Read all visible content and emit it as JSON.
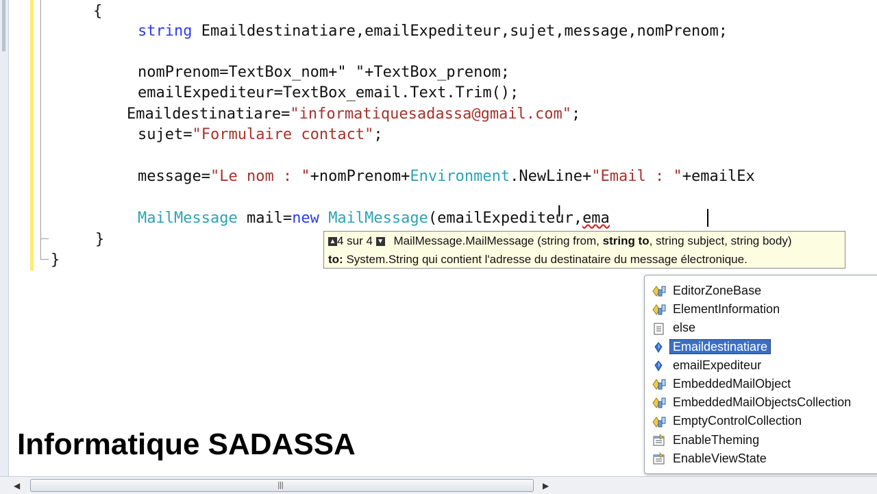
{
  "editor": {
    "open_brace": "{",
    "close_brace_inner": "}",
    "close_brace_outer": "}",
    "line_declare": {
      "kw": "string",
      "rest": " Emaildestinatiare,emailExpediteur,sujet,message,nomPrenom;"
    },
    "line_nomprenom": "nomPrenom=TextBox_nom+\" \"+TextBox_prenom;",
    "line_emailexp": "emailExpediteur=TextBox_email.Text.Trim();",
    "line_emaildest": {
      "pre": "Emaildestinatiare=",
      "str": "\"informatiquesadassa@gmail.com\"",
      "post": ";"
    },
    "line_sujet": {
      "pre": "sujet=",
      "str": "\"Formulaire contact\"",
      "post": ";"
    },
    "line_message": {
      "pre": "message=",
      "str1": "\"Le nom : \"",
      "mid1": "+nomPrenom+",
      "type": "Environment",
      "mid2": ".NewLine+",
      "str2": "\"Email : \"",
      "post": "+emailEx"
    },
    "line_mail": {
      "type1": "MailMessage",
      "mid1": " mail=",
      "kw": "new",
      "sp": " ",
      "type2": "MailMessage",
      "mid2": "(emailExpediteur,",
      "typed": "ema"
    }
  },
  "signature_help": {
    "counter": "4 sur 4",
    "up_arrow": "▲",
    "down_arrow": "▼",
    "sig_pre": "MailMessage.MailMessage (string from, ",
    "sig_bold": "string to",
    "sig_post": ", string subject, string body)",
    "param_name": "to:",
    "param_desc": " System.String qui contient l'adresse du destinataire du message électronique."
  },
  "completion_list": {
    "items": [
      {
        "label": "EditorZoneBase",
        "icon": "class-icon"
      },
      {
        "label": "ElementInformation",
        "icon": "class-icon"
      },
      {
        "label": "else",
        "icon": "snippet-icon"
      },
      {
        "label": "Emaildestinatiare",
        "icon": "local-variable-icon",
        "selected": true
      },
      {
        "label": "emailExpediteur",
        "icon": "local-variable-icon"
      },
      {
        "label": "EmbeddedMailObject",
        "icon": "class-icon"
      },
      {
        "label": "EmbeddedMailObjectsCollection",
        "icon": "class-icon"
      },
      {
        "label": "EmptyControlCollection",
        "icon": "class-icon"
      },
      {
        "label": "EnableTheming",
        "icon": "property-icon"
      },
      {
        "label": "EnableViewState",
        "icon": "property-icon"
      }
    ]
  },
  "watermark": "Informatique SADASSA",
  "colors": {
    "keyword": "#2b3bf0",
    "type": "#2aa3b5",
    "string": "#a8322b",
    "selection": "#3b6fc6",
    "tooltip_bg": "#fdfde2",
    "change_bar": "#ffeb6b"
  }
}
